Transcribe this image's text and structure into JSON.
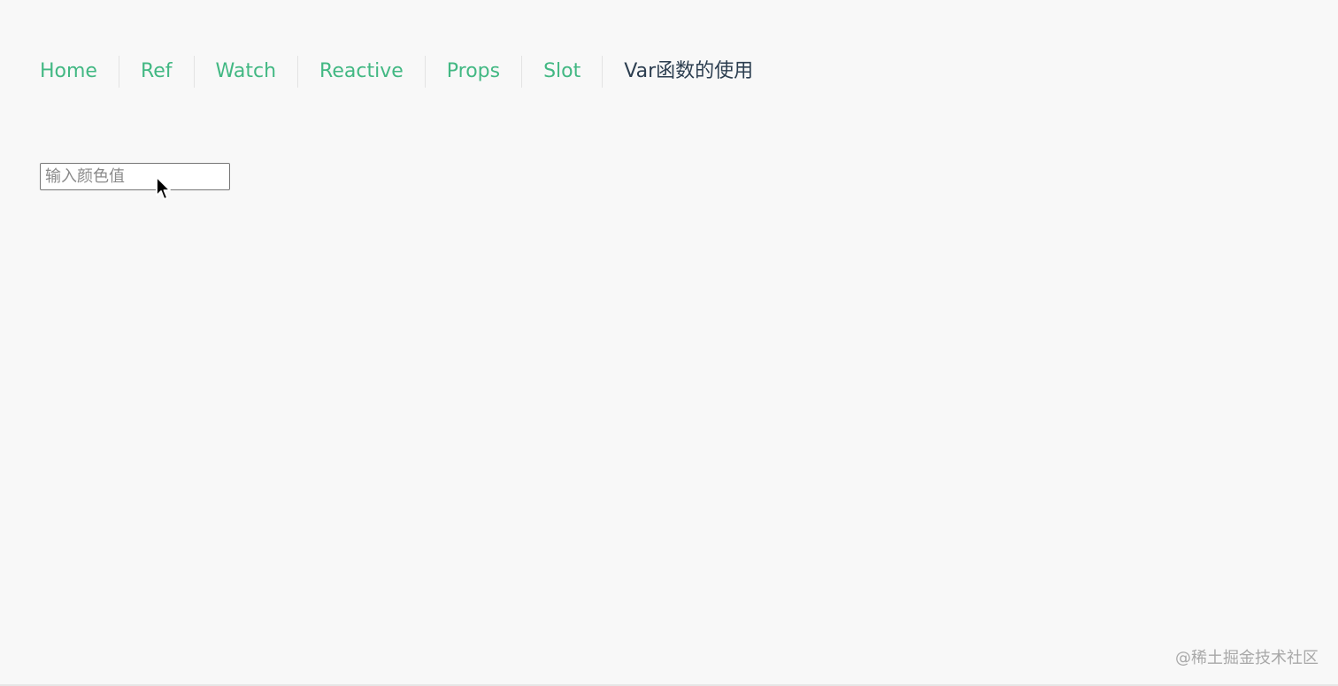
{
  "nav": {
    "items": [
      {
        "label": "Home",
        "active": false
      },
      {
        "label": "Ref",
        "active": false
      },
      {
        "label": "Watch",
        "active": false
      },
      {
        "label": "Reactive",
        "active": false
      },
      {
        "label": "Props",
        "active": false
      },
      {
        "label": "Slot",
        "active": false
      },
      {
        "label": "Var函数的使用",
        "active": true
      }
    ]
  },
  "color_input": {
    "value": "",
    "placeholder": "输入颜色值"
  },
  "watermark": "@稀土掘金技术社区",
  "colors": {
    "link": "#42b883",
    "active_link": "#2c3e50",
    "background": "#f8f8f8",
    "divider": "#e3e3e3",
    "watermark": "#a8a8a8"
  },
  "icons": {
    "cursor": "mouse-pointer-icon"
  }
}
